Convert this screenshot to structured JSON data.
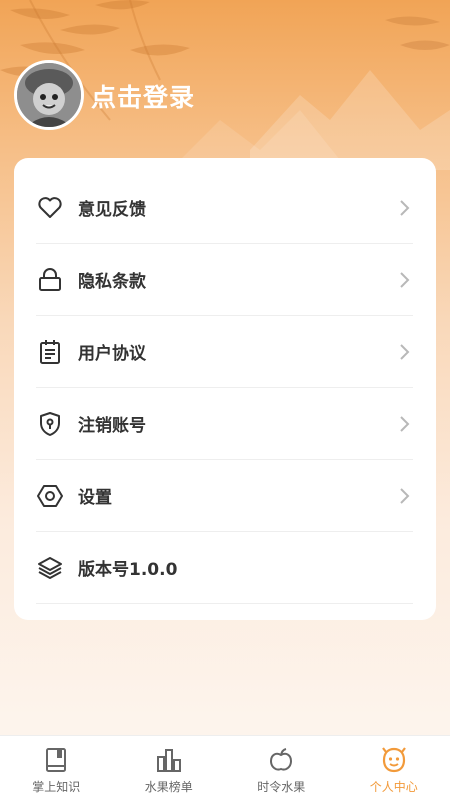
{
  "profile": {
    "login_text": "点击登录"
  },
  "menu": [
    {
      "label": "意见反馈",
      "icon": "heart-icon",
      "has_chevron": true
    },
    {
      "label": "隐私条款",
      "icon": "lock-icon",
      "has_chevron": true
    },
    {
      "label": "用户协议",
      "icon": "notepad-icon",
      "has_chevron": true
    },
    {
      "label": "注销账号",
      "icon": "shield-icon",
      "has_chevron": true
    },
    {
      "label": "设置",
      "icon": "hexagon-nut-icon",
      "has_chevron": true
    },
    {
      "label": "版本号1.0.0",
      "icon": "layers-icon",
      "has_chevron": false
    }
  ],
  "tabs": [
    {
      "label": "掌上知识",
      "icon": "book-icon",
      "active": false
    },
    {
      "label": "水果榜单",
      "icon": "bar-chart-icon",
      "active": false
    },
    {
      "label": "时令水果",
      "icon": "apple-icon",
      "active": false
    },
    {
      "label": "个人中心",
      "icon": "smile-face-icon",
      "active": true
    }
  ],
  "colors": {
    "accent": "#F29A3A",
    "header_orange": "#F1A456",
    "text_dark": "#333333",
    "tab_inactive": "#666666"
  }
}
